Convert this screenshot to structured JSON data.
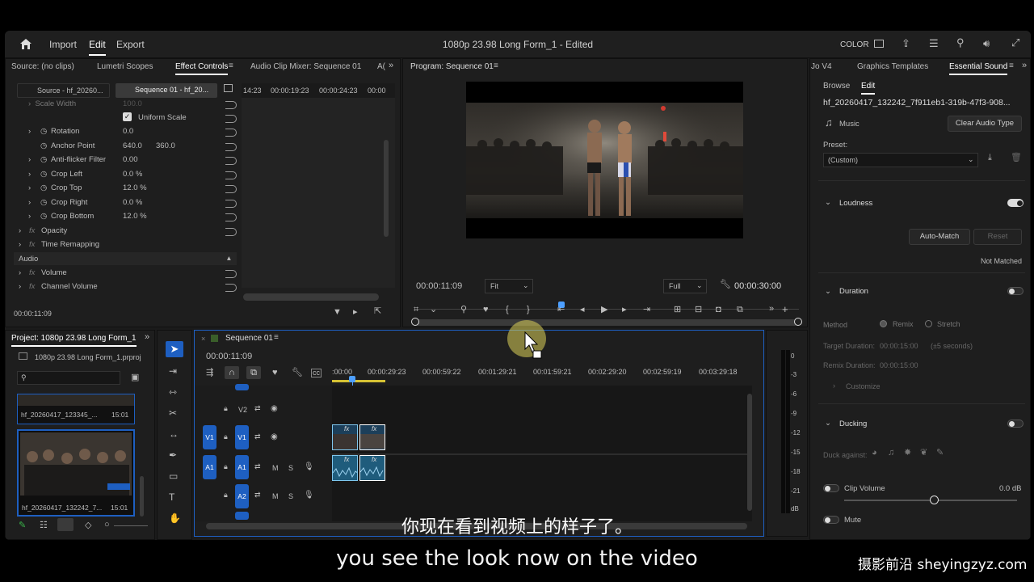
{
  "header": {
    "home_icon": "home-icon",
    "nav": [
      "Import",
      "Edit",
      "Export"
    ],
    "title": "1080p 23.98 Long Form_1 - Edited",
    "color_label": "COLOR"
  },
  "source_panel": {
    "tabs": [
      "Source: (no clips)",
      "Lumetri Scopes",
      "Effect Controls",
      "Audio Clip Mixer: Sequence 01",
      "A("
    ],
    "subtabs": [
      "Source - hf_20260...",
      "Sequence 01 - hf_20..."
    ],
    "ruler": [
      "14:23",
      "00:00:19:23",
      "00:00:24:23",
      "00:00"
    ],
    "scale_width": {
      "label": "Scale Width",
      "value": "100.0"
    },
    "uniform_scale": "Uniform Scale",
    "rotation": {
      "label": "Rotation",
      "value": "0.0"
    },
    "anchor_point": {
      "label": "Anchor Point",
      "x": "640.0",
      "y": "360.0"
    },
    "anti_flicker": {
      "label": "Anti-flicker Filter",
      "value": "0.00"
    },
    "crop_left": {
      "label": "Crop Left",
      "value": "0.0 %"
    },
    "crop_top": {
      "label": "Crop Top",
      "value": "12.0 %"
    },
    "crop_right": {
      "label": "Crop Right",
      "value": "0.0 %"
    },
    "crop_bottom": {
      "label": "Crop Bottom",
      "value": "12.0 %"
    },
    "opacity": "Opacity",
    "time_remapping": "Time Remapping",
    "audio_section": "Audio",
    "volume": "Volume",
    "channel_volume": "Channel Volume",
    "timecode": "00:00:11:09"
  },
  "program_panel": {
    "title": "Program: Sequence 01",
    "timecode": "00:00:11:09",
    "fit": "Fit",
    "full": "Full",
    "duration": "00:00:30:00"
  },
  "essential_sound": {
    "tabs": [
      "Jo V4",
      "Graphics Templates",
      "Essential Sound"
    ],
    "subtabs": [
      "Browse",
      "Edit"
    ],
    "clip_name": "hf_20260417_132242_7f911eb1-319b-47f3-908...",
    "music_label": "Music",
    "clear_audio_type": "Clear Audio Type",
    "preset_label": "Preset:",
    "preset_value": "(Custom)",
    "loudness": "Loudness",
    "auto_match": "Auto-Match",
    "reset": "Reset",
    "not_matched": "Not Matched",
    "duration": "Duration",
    "method_label": "Method",
    "remix": "Remix",
    "stretch": "Stretch",
    "target_duration": "Target Duration:",
    "target_duration_value": "00:00:15:00",
    "target_duration_range": "(±5 seconds)",
    "remix_duration": "Remix Duration:",
    "remix_duration_value": "00:00:15:00",
    "customize": "Customize",
    "ducking": "Ducking",
    "duck_against": "Duck against:",
    "clip_volume": "Clip Volume",
    "clip_volume_value": "0.0 dB",
    "mute": "Mute"
  },
  "project_panel": {
    "title": "Project: 1080p 23.98 Long Form_1",
    "file": "1080p 23.98 Long Form_1.prproj",
    "items": [
      {
        "name": "hf_20260417_123345_...",
        "duration": "15:01"
      },
      {
        "name": "hf_20260417_132242_7...",
        "duration": "15:01"
      }
    ]
  },
  "timeline": {
    "title": "Sequence 01",
    "timecode": "00:00:11:09",
    "ruler": [
      ":00:00",
      "00:00:29:23",
      "00:00:59:22",
      "00:01:29:21",
      "00:01:59:21",
      "00:02:29:20",
      "00:02:59:19",
      "00:03:29:18"
    ],
    "tracks": {
      "v2": "V2",
      "v1": "V1",
      "a1": "A1",
      "a2": "A2",
      "m": "M",
      "s": "S"
    }
  },
  "meter": {
    "scale": [
      "0",
      "-3",
      "-6",
      "-9",
      "-12",
      "-15",
      "-18",
      "-21",
      "dB"
    ]
  },
  "subtitles": {
    "chinese": "你现在看到视频上的样子了。",
    "english": "you see the look now on the video"
  },
  "watermark": "摄影前沿 sheyingzyz.com"
}
